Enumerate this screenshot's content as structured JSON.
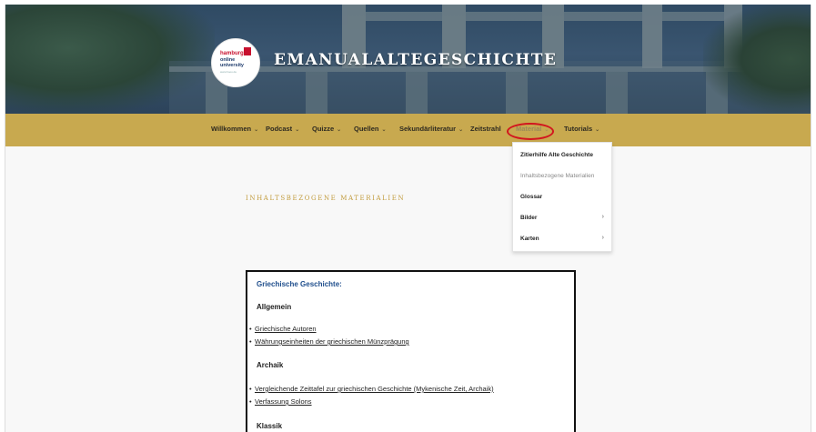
{
  "header": {
    "site_title": "EMANUALALTEGESCHICHTE",
    "logo": {
      "line1": "hamburg",
      "line2a": "online",
      "line2b": "university",
      "line3": "www.hoou.de"
    }
  },
  "nav": {
    "items": [
      {
        "label": "Willkommen",
        "chevron": "⌄"
      },
      {
        "label": "Podcast",
        "chevron": "⌄"
      },
      {
        "label": "Quizze",
        "chevron": "⌄"
      },
      {
        "label": "Quellen",
        "chevron": "⌄"
      },
      {
        "label": "Sekundärliteratur",
        "chevron": "⌄"
      },
      {
        "label": "Zeitstrahl",
        "chevron": ""
      },
      {
        "label": "Material",
        "chevron": "⌄"
      },
      {
        "label": "Tutorials",
        "chevron": "⌄"
      }
    ],
    "active_index": 6,
    "highlight_color": "#d2161e"
  },
  "dropdown": {
    "items": [
      {
        "label": "Zitierhilfe Alte Geschichte",
        "has_submenu": false,
        "current": false
      },
      {
        "label": "Inhaltsbezogene Materialien",
        "has_submenu": false,
        "current": true
      },
      {
        "label": "Glossar",
        "has_submenu": false,
        "current": false
      },
      {
        "label": "Bilder",
        "has_submenu": true,
        "current": false
      },
      {
        "label": "Karten",
        "has_submenu": true,
        "current": false
      }
    ],
    "submenu_arrow": "›"
  },
  "page": {
    "heading": "INHALTSBEZOGENE MATERIALIEN",
    "accent_color": "#c29c3e"
  },
  "content": {
    "title": "Griechische Geschichte:",
    "sections": [
      {
        "name": "Allgemein",
        "links": [
          "Griechische Autoren",
          "Währungseinheiten der griechischen Münzprägung"
        ]
      },
      {
        "name": "Archaik",
        "links": [
          "Vergleichende Zeittafel zur griechischen Geschichte (Mykenische Zeit, Archaik)",
          "Verfassung Solons"
        ]
      },
      {
        "name": "Klassik",
        "links": []
      }
    ],
    "bullet": "•"
  },
  "colors": {
    "nav_bar": "#c8a94f",
    "link_title": "#1f4e8c"
  }
}
